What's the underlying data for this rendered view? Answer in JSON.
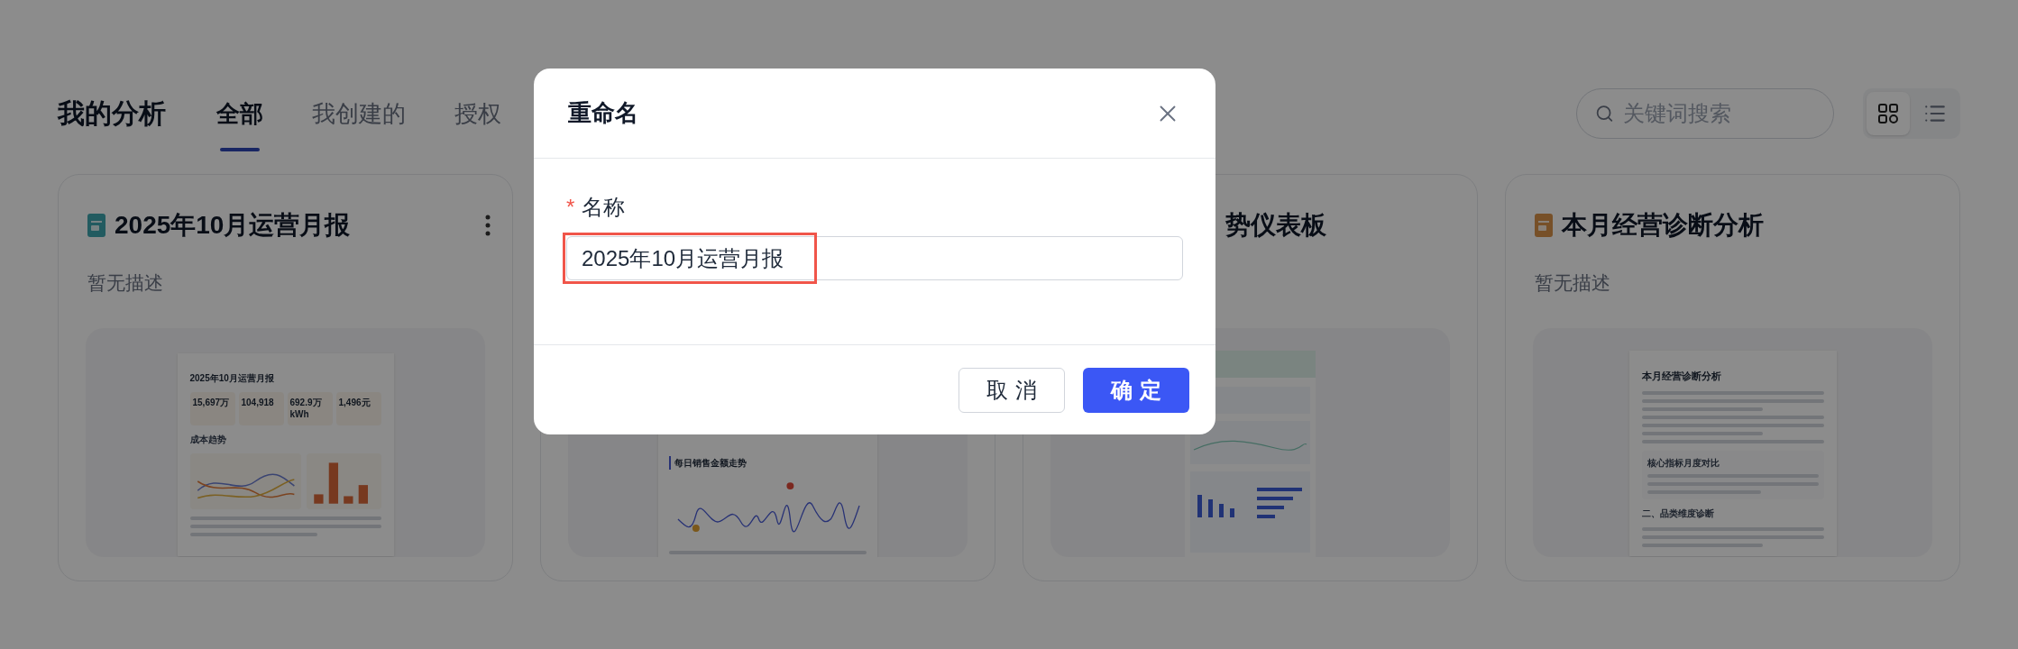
{
  "page": {
    "title": "我的分析",
    "tabs": [
      {
        "label": "全部",
        "selected": true
      },
      {
        "label": "我创建的",
        "selected": false
      },
      {
        "label": "授权",
        "selected": false
      }
    ]
  },
  "search": {
    "placeholder": "关键词搜索"
  },
  "view_toggle": [
    {
      "kind": "grid",
      "selected": true
    },
    {
      "kind": "list",
      "selected": false
    }
  ],
  "cards": [
    {
      "icon": true,
      "title": "2025年10月运营月报",
      "description": "暂无描述",
      "menu": true,
      "preview": {
        "kind": "report",
        "title": "2025年10月运营月报",
        "kpis": [
          "15,697万",
          "104,918",
          "692.9万 kWh",
          "1,496元"
        ],
        "section": "成本趋势"
      }
    },
    {
      "preview": {
        "kind": "line_chart",
        "title": "每日销售金额走势"
      }
    },
    {
      "title": "势仪表板",
      "preview": {
        "kind": "dashboard"
      }
    },
    {
      "icon": true,
      "title": "本月经营诊断分析",
      "description": "暂无描述",
      "preview": {
        "kind": "text_report",
        "title": "本月经营诊断分析",
        "headings": [
          "核心指标月度对比",
          "二、品类维度诊断"
        ]
      }
    }
  ],
  "dialog": {
    "title": "重命名",
    "field": {
      "label": "名称",
      "required_mark": "*",
      "value": "2025年10月运营月报",
      "highlighted": true
    },
    "buttons": [
      {
        "label": "取消",
        "kind": "secondary"
      },
      {
        "label": "确定",
        "kind": "primary"
      }
    ]
  }
}
